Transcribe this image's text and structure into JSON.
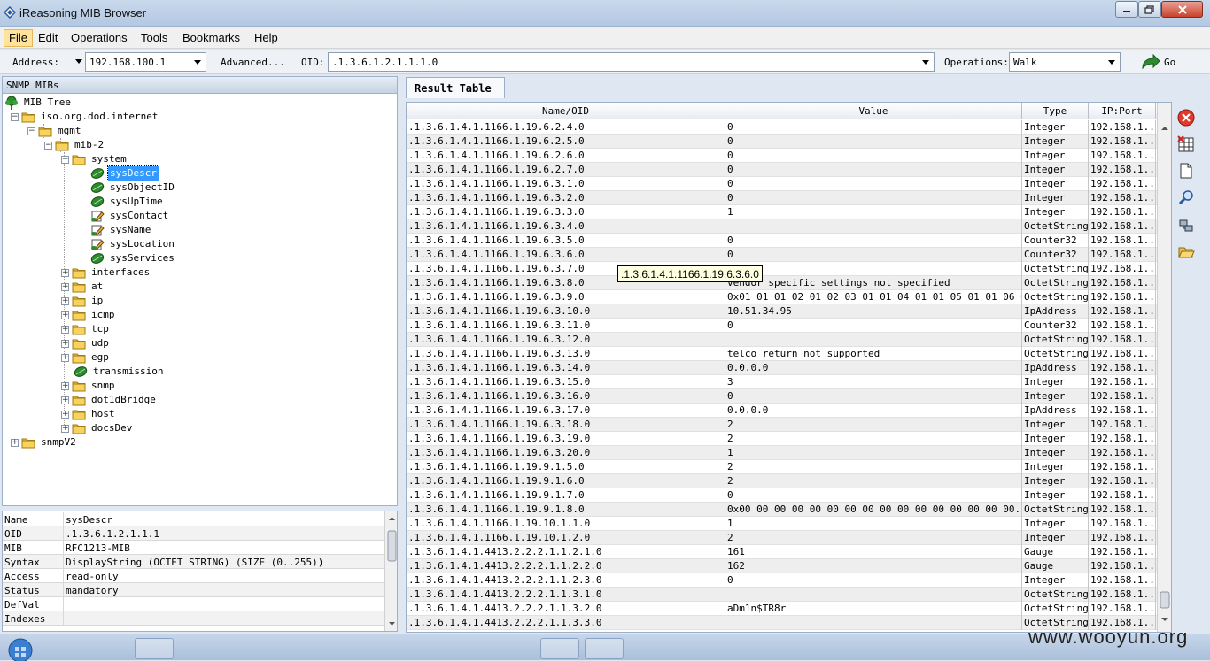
{
  "window": {
    "title": "iReasoning MIB Browser"
  },
  "menu": [
    "File",
    "Edit",
    "Operations",
    "Tools",
    "Bookmarks",
    "Help"
  ],
  "toolbar": {
    "address_label": "Address:",
    "address_value": "192.168.100.1",
    "advanced_label": "Advanced...",
    "oid_label": "OID:",
    "oid_value": ".1.3.6.1.2.1.1.1.0",
    "operations_label": "Operations:",
    "operations_value": "Walk",
    "go_label": "Go"
  },
  "left_panel": {
    "header": "SNMP MIBs",
    "tree": [
      {
        "label": "MIB Tree",
        "icon": "tree-icon",
        "depth": 0
      },
      {
        "label": "iso.org.dod.internet",
        "icon": "folder-icon",
        "depth": 1,
        "exp": "-"
      },
      {
        "label": "mgmt",
        "icon": "folder-icon",
        "depth": 2,
        "exp": "-"
      },
      {
        "label": "mib-2",
        "icon": "folder-icon",
        "depth": 3,
        "exp": "-"
      },
      {
        "label": "system",
        "icon": "folder-icon",
        "depth": 4,
        "exp": "-"
      },
      {
        "label": "sysDescr",
        "icon": "leaf-icon",
        "depth": 5,
        "selected": true
      },
      {
        "label": "sysObjectID",
        "icon": "leaf-icon",
        "depth": 5
      },
      {
        "label": "sysUpTime",
        "icon": "leaf-icon",
        "depth": 5
      },
      {
        "label": "sysContact",
        "icon": "edit-leaf-icon",
        "depth": 5
      },
      {
        "label": "sysName",
        "icon": "edit-leaf-icon",
        "depth": 5
      },
      {
        "label": "sysLocation",
        "icon": "edit-leaf-icon",
        "depth": 5
      },
      {
        "label": "sysServices",
        "icon": "leaf-icon",
        "depth": 5
      },
      {
        "label": "interfaces",
        "icon": "folder-icon",
        "depth": 4,
        "exp": "+"
      },
      {
        "label": "at",
        "icon": "folder-icon",
        "depth": 4,
        "exp": "+"
      },
      {
        "label": "ip",
        "icon": "folder-icon",
        "depth": 4,
        "exp": "+"
      },
      {
        "label": "icmp",
        "icon": "folder-icon",
        "depth": 4,
        "exp": "+"
      },
      {
        "label": "tcp",
        "icon": "folder-icon",
        "depth": 4,
        "exp": "+"
      },
      {
        "label": "udp",
        "icon": "folder-icon",
        "depth": 4,
        "exp": "+"
      },
      {
        "label": "egp",
        "icon": "folder-icon",
        "depth": 4,
        "exp": "+"
      },
      {
        "label": "transmission",
        "icon": "leaf-icon",
        "depth": 4
      },
      {
        "label": "snmp",
        "icon": "folder-icon",
        "depth": 4,
        "exp": "+"
      },
      {
        "label": "dot1dBridge",
        "icon": "folder-icon",
        "depth": 4,
        "exp": "+"
      },
      {
        "label": "host",
        "icon": "folder-icon",
        "depth": 4,
        "exp": "+"
      },
      {
        "label": "docsDev",
        "icon": "folder-icon",
        "depth": 4,
        "exp": "+"
      },
      {
        "label": "snmpV2",
        "icon": "folder-icon",
        "depth": 1,
        "exp": "+"
      }
    ],
    "properties": [
      {
        "key": "Name",
        "value": "sysDescr"
      },
      {
        "key": "OID",
        "value": ".1.3.6.1.2.1.1.1"
      },
      {
        "key": "MIB",
        "value": "RFC1213-MIB"
      },
      {
        "key": "Syntax",
        "value": "DisplayString (OCTET STRING) (SIZE (0..255))"
      },
      {
        "key": "Access",
        "value": "read-only"
      },
      {
        "key": "Status",
        "value": "mandatory"
      },
      {
        "key": "DefVal",
        "value": ""
      },
      {
        "key": "Indexes",
        "value": ""
      }
    ]
  },
  "result": {
    "tab": "Result Table",
    "columns": [
      "Name/OID",
      "Value",
      "Type",
      "IP:Port"
    ],
    "rows": [
      [
        ".1.3.6.1.4.1.1166.1.19.6.2.4.0",
        "0",
        "Integer",
        "192.168.1..."
      ],
      [
        ".1.3.6.1.4.1.1166.1.19.6.2.5.0",
        "0",
        "Integer",
        "192.168.1..."
      ],
      [
        ".1.3.6.1.4.1.1166.1.19.6.2.6.0",
        "0",
        "Integer",
        "192.168.1..."
      ],
      [
        ".1.3.6.1.4.1.1166.1.19.6.2.7.0",
        "0",
        "Integer",
        "192.168.1..."
      ],
      [
        ".1.3.6.1.4.1.1166.1.19.6.3.1.0",
        "0",
        "Integer",
        "192.168.1..."
      ],
      [
        ".1.3.6.1.4.1.1166.1.19.6.3.2.0",
        "0",
        "Integer",
        "192.168.1..."
      ],
      [
        ".1.3.6.1.4.1.1166.1.19.6.3.3.0",
        "1",
        "Integer",
        "192.168.1..."
      ],
      [
        ".1.3.6.1.4.1.1166.1.19.6.3.4.0",
        "",
        "OctetString",
        "192.168.1..."
      ],
      [
        ".1.3.6.1.4.1.1166.1.19.6.3.5.0",
        "0",
        "Counter32",
        "192.168.1..."
      ],
      [
        ".1.3.6.1.4.1.1166.1.19.6.3.6.0",
        "0",
        "Counter32",
        "192.168.1..."
      ],
      [
        ".1.3.6.1.4.1.1166.1.19.6.3.7.0",
        "F2",
        "OctetString",
        "192.168.1..."
      ],
      [
        ".1.3.6.1.4.1.1166.1.19.6.3.8.0",
        "vendor specific settings not specified",
        "OctetString",
        "192.168.1..."
      ],
      [
        ".1.3.6.1.4.1.1166.1.19.6.3.9.0",
        "0x01 01 01 02 01 02 03 01 01 04 01 01 05 01 01 06 01...",
        "OctetString",
        "192.168.1..."
      ],
      [
        ".1.3.6.1.4.1.1166.1.19.6.3.10.0",
        "10.51.34.95",
        "IpAddress",
        "192.168.1..."
      ],
      [
        ".1.3.6.1.4.1.1166.1.19.6.3.11.0",
        "0",
        "Counter32",
        "192.168.1..."
      ],
      [
        ".1.3.6.1.4.1.1166.1.19.6.3.12.0",
        "",
        "OctetString",
        "192.168.1..."
      ],
      [
        ".1.3.6.1.4.1.1166.1.19.6.3.13.0",
        "telco return not supported",
        "OctetString",
        "192.168.1..."
      ],
      [
        ".1.3.6.1.4.1.1166.1.19.6.3.14.0",
        "0.0.0.0",
        "IpAddress",
        "192.168.1..."
      ],
      [
        ".1.3.6.1.4.1.1166.1.19.6.3.15.0",
        "3",
        "Integer",
        "192.168.1..."
      ],
      [
        ".1.3.6.1.4.1.1166.1.19.6.3.16.0",
        "0",
        "Integer",
        "192.168.1..."
      ],
      [
        ".1.3.6.1.4.1.1166.1.19.6.3.17.0",
        "0.0.0.0",
        "IpAddress",
        "192.168.1..."
      ],
      [
        ".1.3.6.1.4.1.1166.1.19.6.3.18.0",
        "2",
        "Integer",
        "192.168.1..."
      ],
      [
        ".1.3.6.1.4.1.1166.1.19.6.3.19.0",
        "2",
        "Integer",
        "192.168.1..."
      ],
      [
        ".1.3.6.1.4.1.1166.1.19.6.3.20.0",
        "1",
        "Integer",
        "192.168.1..."
      ],
      [
        ".1.3.6.1.4.1.1166.1.19.9.1.5.0",
        "2",
        "Integer",
        "192.168.1..."
      ],
      [
        ".1.3.6.1.4.1.1166.1.19.9.1.6.0",
        "2",
        "Integer",
        "192.168.1..."
      ],
      [
        ".1.3.6.1.4.1.1166.1.19.9.1.7.0",
        "0",
        "Integer",
        "192.168.1..."
      ],
      [
        ".1.3.6.1.4.1.1166.1.19.9.1.8.0",
        "0x00 00 00 00 00 00 00 00 00 00 00 00 00 00 00 00...",
        "OctetString",
        "192.168.1..."
      ],
      [
        ".1.3.6.1.4.1.1166.1.19.10.1.1.0",
        "1",
        "Integer",
        "192.168.1..."
      ],
      [
        ".1.3.6.1.4.1.1166.1.19.10.1.2.0",
        "2",
        "Integer",
        "192.168.1..."
      ],
      [
        ".1.3.6.1.4.1.4413.2.2.2.1.1.2.1.0",
        "161",
        "Gauge",
        "192.168.1..."
      ],
      [
        ".1.3.6.1.4.1.4413.2.2.2.1.1.2.2.0",
        "162",
        "Gauge",
        "192.168.1..."
      ],
      [
        ".1.3.6.1.4.1.4413.2.2.2.1.1.2.3.0",
        "0",
        "Integer",
        "192.168.1..."
      ],
      [
        ".1.3.6.1.4.1.4413.2.2.2.1.1.3.1.0",
        "",
        "OctetString",
        "192.168.1..."
      ],
      [
        ".1.3.6.1.4.1.4413.2.2.2.1.1.3.2.0",
        "aDm1n$TR8r",
        "OctetString",
        "192.168.1..."
      ],
      [
        ".1.3.6.1.4.1.4413.2.2.2.1.1.3.3.0",
        "",
        "OctetString",
        "192.168.1..."
      ]
    ],
    "tooltip": ".1.3.6.1.4.1.1166.1.19.6.3.6.0"
  },
  "side_tools": [
    "stop-icon",
    "table-icon",
    "document-icon",
    "search-icon",
    "network-icon",
    "open-folder-icon"
  ],
  "watermark": "www.wooyun.org",
  "colors": {
    "selection": "#3399ff",
    "tooltip_bg": "#ffffe1",
    "close": "#c7422c"
  }
}
